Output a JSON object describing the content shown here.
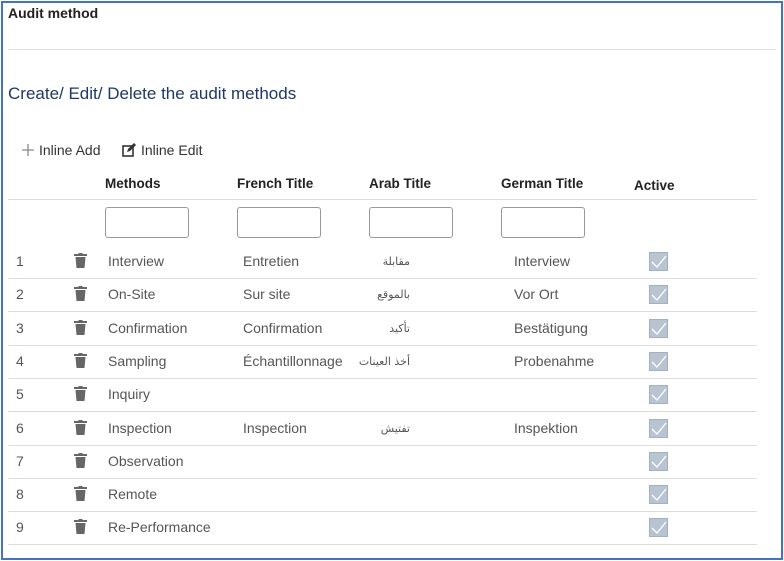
{
  "header": {
    "title": "Audit method",
    "subtitle": "Create/ Edit/ Delete the audit methods"
  },
  "toolbar": {
    "add_label": "Inline Add",
    "edit_label": "Inline Edit"
  },
  "columns": {
    "methods": "Methods",
    "french": "French Title",
    "arab": "Arab Title",
    "german": "German Title",
    "active": "Active"
  },
  "rows": [
    {
      "num": "1",
      "method": "Interview",
      "french": "Entretien",
      "arab": "مقابلة",
      "german": "Interview",
      "active": true
    },
    {
      "num": "2",
      "method": "On-Site",
      "french": "Sur site",
      "arab": "بالموقع",
      "german": "Vor Ort",
      "active": true
    },
    {
      "num": "3",
      "method": "Confirmation",
      "french": "Confirmation",
      "arab": "تأكيد",
      "german": "Bestätigung",
      "active": true
    },
    {
      "num": "4",
      "method": "Sampling",
      "french": "Échantillonnage",
      "arab": "أخذ العينات",
      "german": "Probenahme",
      "active": true
    },
    {
      "num": "5",
      "method": "Inquiry",
      "french": "",
      "arab": "",
      "german": "",
      "active": true
    },
    {
      "num": "6",
      "method": "Inspection",
      "french": "Inspection",
      "arab": "تفتيش",
      "german": "Inspektion",
      "active": true
    },
    {
      "num": "7",
      "method": "Observation",
      "french": "",
      "arab": "",
      "german": "",
      "active": true
    },
    {
      "num": "8",
      "method": "Remote",
      "french": "",
      "arab": "",
      "german": "",
      "active": true
    },
    {
      "num": "9",
      "method": "Re-Performance",
      "french": "",
      "arab": "",
      "german": "",
      "active": true
    }
  ],
  "colors": {
    "frame": "#4472c4",
    "subtitle": "#1f3864",
    "checkbox": "#b8c4d2"
  }
}
